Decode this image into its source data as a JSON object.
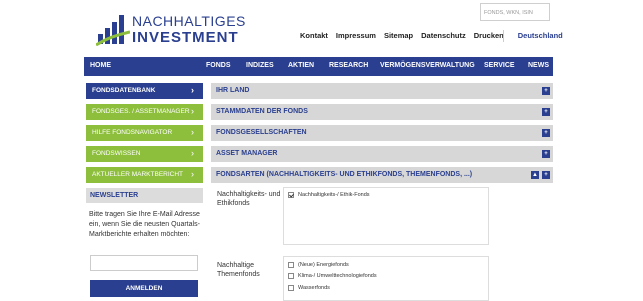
{
  "header": {
    "logo_line1": "NACHHALTIGES",
    "logo_line2": "INVESTMENT",
    "search_placeholder": "FONDS, WKN, ISIN",
    "brand_color": "#2a3f8f",
    "accent_color": "#8dbf3c"
  },
  "topnav": [
    "Kontakt",
    "Impressum",
    "Sitemap",
    "Datenschutz",
    "Drucken",
    "Deutschland"
  ],
  "mainnav": [
    "HOME",
    "FONDS",
    "INDIZES",
    "AKTIEN",
    "RESEARCH",
    "VERMÖGENSVERWALTUNG",
    "SERVICE",
    "NEWS"
  ],
  "sidebar": {
    "items": [
      {
        "label": "FONDSDATENBANK",
        "style": "blue"
      },
      {
        "label": "FONDSGES. / ASSETMANAGER",
        "style": "green"
      },
      {
        "label": "HILFE FONDSNAVIGATOR",
        "style": "green"
      },
      {
        "label": "FONDSWISSEN",
        "style": "green"
      },
      {
        "label": "AKTUELLER MARKTBERICHT",
        "style": "green"
      }
    ],
    "chevron": "›"
  },
  "newsletter": {
    "heading": "NEWSLETTER",
    "text": "Bitte tragen Sie Ihre E-Mail Adresse ein, wenn Sie die neusten Quartals-Marktberichte erhalten möchten:",
    "button": "ANMELDEN"
  },
  "accordion": [
    {
      "label": "IHR LAND"
    },
    {
      "label": "STAMMDATEN DER FONDS"
    },
    {
      "label": "FONDSGESELLSCHAFTEN"
    },
    {
      "label": "ASSET MANAGER"
    },
    {
      "label": "FONDSARTEN (NACHHALTIGKEITS- UND ETHIKFONDS, THEMENFONDS, ...)"
    }
  ],
  "filters": {
    "group1_label": "Nachhaltigkeits- und Ethikfonds",
    "group1_options": [
      {
        "label": "Nachhaltigkeits-/ Ethik-Fonds",
        "checked": true
      }
    ],
    "group2_label": "Nachhaltige Themenfonds",
    "group2_options": [
      {
        "label": "(Neue) Energiefonds",
        "checked": false
      },
      {
        "label": "Klima-/ Umwelttechnologiefonds",
        "checked": false
      },
      {
        "label": "Wasserfonds",
        "checked": false
      }
    ]
  },
  "icons": {
    "plus": "+",
    "up": "▲"
  }
}
